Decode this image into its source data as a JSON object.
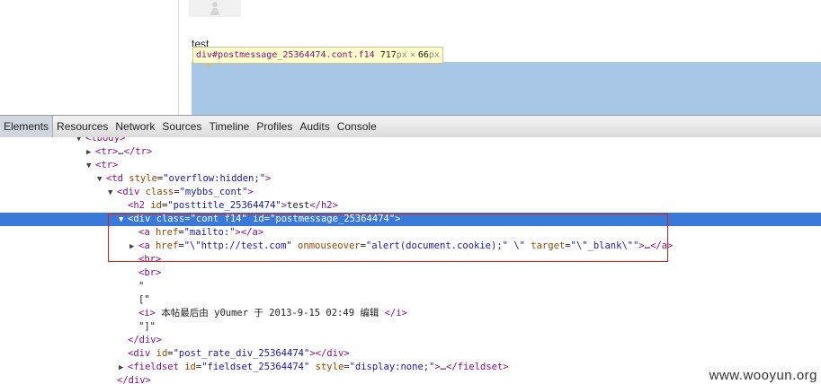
{
  "preview": {
    "post_title": "test",
    "tooltip": {
      "selector": "div#postmessage_25364474.cont.f14",
      "width": "717",
      "width_unit": "px",
      "times": "×",
      "height": "66",
      "height_unit": "px"
    }
  },
  "devtools": {
    "tabs": [
      "Elements",
      "Resources",
      "Network",
      "Sources",
      "Timeline",
      "Profiles",
      "Audits",
      "Console"
    ],
    "active_tab": "Elements"
  },
  "tree": {
    "lines": [
      "<tbody>",
      "<tr>…</tr>",
      "<tr>",
      "<td style=\"overflow:hidden;\">",
      "<div class=\"mybbs_cont\">",
      "<h2 id=\"posttitle_25364474\">test</h2>",
      "<div class=\"cont f14\" id=\"postmessage_25364474\">",
      "<a href=\"mailto:\"></a>",
      "<a href=\"\\\"http://test.com\" onmouseover=\"alert(document.cookie);\" \\\" target=\"\\\"_blank\\\"\">…</a>",
      "<br>",
      "<br>",
      "\"",
      "[\"",
      "<i> 本帖最后由 y0umer 于 2013-9-15 02:49 编辑 </i>",
      "\"]\"",
      "</div>",
      "<div id=\"post_rate_div_25364474\"></div>",
      "<fieldset id=\"fieldset_25364474\" style=\"display:none;\">…</fieldset>",
      "</div>"
    ]
  },
  "watermark": "www.wooyun.org",
  "colors": {
    "selection": "#3879d9",
    "tag": "#881280",
    "attr_name": "#994500",
    "attr_value": "#1a1aa6",
    "highlight_box": "#d02020"
  }
}
